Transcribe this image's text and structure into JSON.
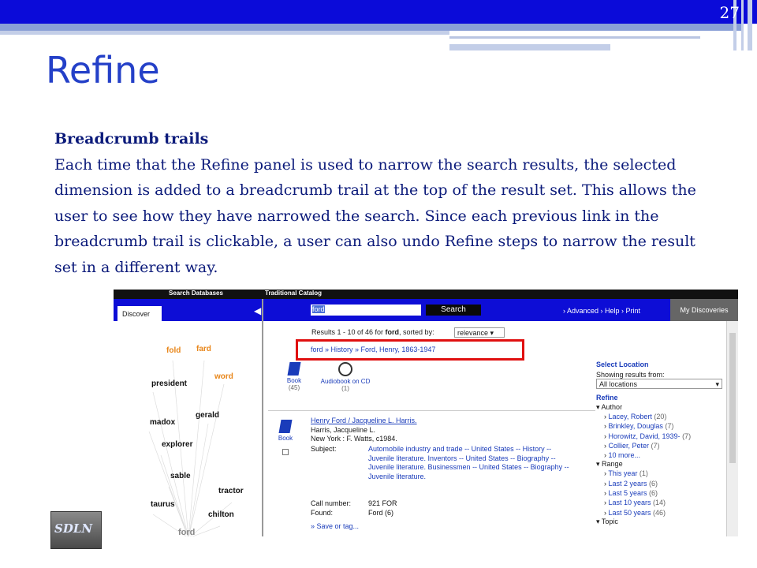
{
  "slide": {
    "number": "27",
    "title": "Refine",
    "heading": "Breadcrumb trails",
    "paragraph": "Each time that the Refine panel is used to narrow the search results, the selected dimension is added to a breadcrumb trail at the top of the result set. This allows the user to see how they have narrowed the search. Since each previous link in the breadcrumb trail is clickable, a user can also undo Refine steps to narrow the result set in a different way.",
    "logo_text": "SDLN"
  },
  "screenshot": {
    "nav": {
      "search_databases": "Search Databases",
      "traditional_catalog": "Traditional Catalog"
    },
    "tab_discover": "Discover",
    "search_value": "ford",
    "search_button": "Search",
    "top_links": "› Advanced  › Help  › Print",
    "my_discoveries": "My Discoveries",
    "cloud_words": {
      "fold": "fold",
      "fard": "fard",
      "word": "word",
      "president": "president",
      "gerald": "gerald",
      "madox": "madox",
      "explorer": "explorer",
      "sable": "sable",
      "tractor": "tractor",
      "taurus": "taurus",
      "chilton": "chilton",
      "ford": "ford"
    },
    "results_prefix": "Results 1 - 10 of 46 for ",
    "results_term": "ford",
    "results_suffix": ", sorted by:",
    "sort_value": "relevance",
    "breadcrumb": "ford  » History  » Ford, Henry, 1863-1947",
    "formats": [
      {
        "label": "Book",
        "count": "(45)"
      },
      {
        "label": "Audiobook on CD",
        "count": "(1)"
      }
    ],
    "record": {
      "type": "Book",
      "title_link": "Henry Ford / Jacqueline L. Harris.",
      "author": "Harris, Jacqueline L.",
      "publication": "New York : F. Watts, c1984.",
      "subject_label": "Subject:",
      "subject_value": "Automobile industry and trade -- United States -- History -- Juvenile literature. Inventors -- United States -- Biography -- Juvenile literature. Businessmen -- United States -- Biography -- Juvenile literature.",
      "call_label": "Call number:",
      "call_value": "921 FOR",
      "found_label": "Found:",
      "found_value": "Ford (6)",
      "save_link": "» Save or tag..."
    },
    "sidebar": {
      "select_location": "Select Location",
      "showing_from": "Showing results from:",
      "location_value": "All locations",
      "refine": "Refine",
      "author_label": "Author",
      "authors": [
        {
          "name": "Lacey, Robert",
          "count": "(20)"
        },
        {
          "name": "Brinkley, Douglas",
          "count": "(7)"
        },
        {
          "name": "Horowitz, David, 1939-",
          "count": "(7)"
        },
        {
          "name": "Collier, Peter",
          "count": "(7)"
        },
        {
          "name": "10 more...",
          "count": ""
        }
      ],
      "range_label": "Range",
      "ranges": [
        {
          "name": "This year",
          "count": "(1)"
        },
        {
          "name": "Last 2 years",
          "count": "(6)"
        },
        {
          "name": "Last 5 years",
          "count": "(6)"
        },
        {
          "name": "Last 10 years",
          "count": "(14)"
        },
        {
          "name": "Last 50 years",
          "count": "(46)"
        }
      ],
      "topic_label": "Topic"
    },
    "colors": {
      "nav_blue": "#0d0dd6",
      "link_blue": "#1a3cba",
      "highlight_red": "#e01010",
      "cloud_orange": "#e8861a"
    }
  }
}
